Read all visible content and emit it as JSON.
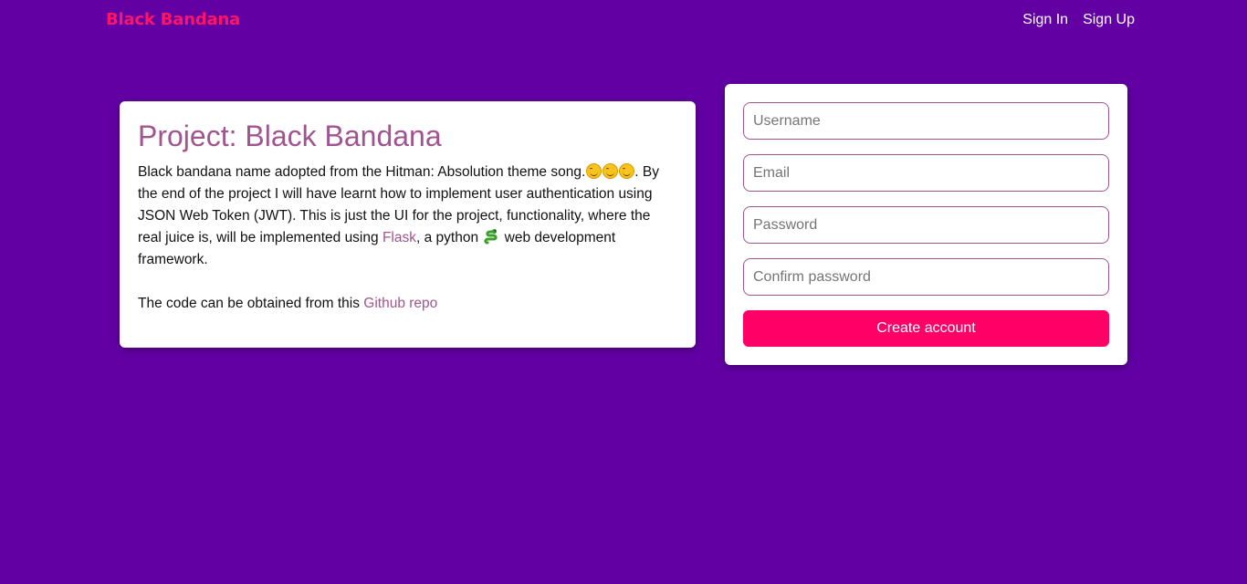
{
  "navbar": {
    "brand": "Black Bandana",
    "links": [
      "Sign In",
      "Sign Up"
    ]
  },
  "info": {
    "title": "Project: Black Bandana",
    "p1_start": "Black bandana name adopted from the Hitman: Absolution theme song.",
    "emoji_icon": "smiling-face-icon",
    "p1_after_emoji": ". By the end of the project I will have learnt how to implement user authentication using JSON Web Token (JWT). This is just the UI for the project, functionality, where the real juice is, will be implemented using ",
    "flask_link": "Flask",
    "p1_after_flask": ", a python ",
    "snake_icon": "snake-icon",
    "p1_end": " web development framework.",
    "repo_prefix": "The code can be obtained from this ",
    "repo_link": "Github repo"
  },
  "form": {
    "username_placeholder": "Username",
    "email_placeholder": "Email",
    "password_placeholder": "Password",
    "confirm_placeholder": "Confirm password",
    "submit_label": "Create account"
  },
  "colors": {
    "background": "#6200a4",
    "brand": "#ff1466",
    "accent": "#a0558f",
    "button": "#ff0066"
  }
}
